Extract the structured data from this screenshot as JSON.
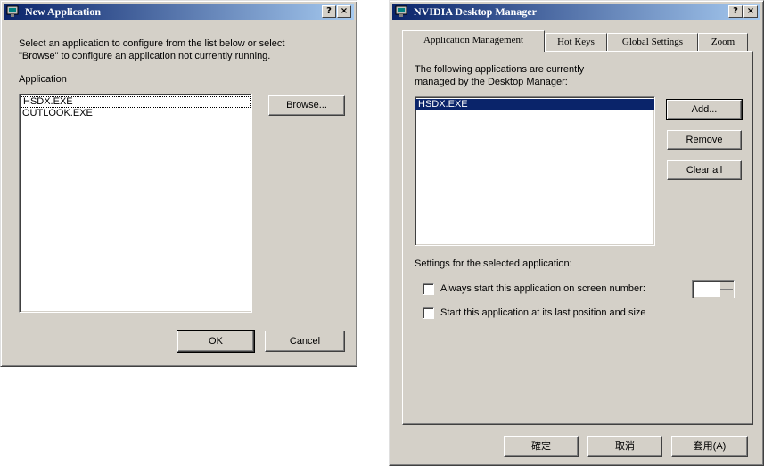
{
  "new_app_dialog": {
    "title": "New Application",
    "help_button": "?",
    "close_button": "×",
    "instructions_line1": "Select an application to configure from the list below or select",
    "instructions_line2": "\"Browse\" to configure an application not currently running.",
    "list_label": "Application",
    "items": [
      "HSDX.EXE",
      "OUTLOOK.EXE"
    ],
    "browse_button": "Browse...",
    "ok_button": "OK",
    "cancel_button": "Cancel"
  },
  "desktop_manager": {
    "title": "NVIDIA Desktop Manager",
    "help_button": "?",
    "close_button": "×",
    "tabs": [
      "Application Management",
      "Hot Keys",
      "Global Settings",
      "Zoom"
    ],
    "description_line1": "The following applications are currently",
    "description_line2": "managed by the Desktop Manager:",
    "items": [
      "HSDX.EXE"
    ],
    "add_button": "Add...",
    "remove_button": "Remove",
    "clear_all_button": "Clear all",
    "settings_label": "Settings for the selected application:",
    "checkbox1_label": "Always start this application on screen number:",
    "checkbox2_label": "Start this application at its last position and size",
    "ok_button": "確定",
    "cancel_button": "取消",
    "apply_button": "套用(A)"
  }
}
